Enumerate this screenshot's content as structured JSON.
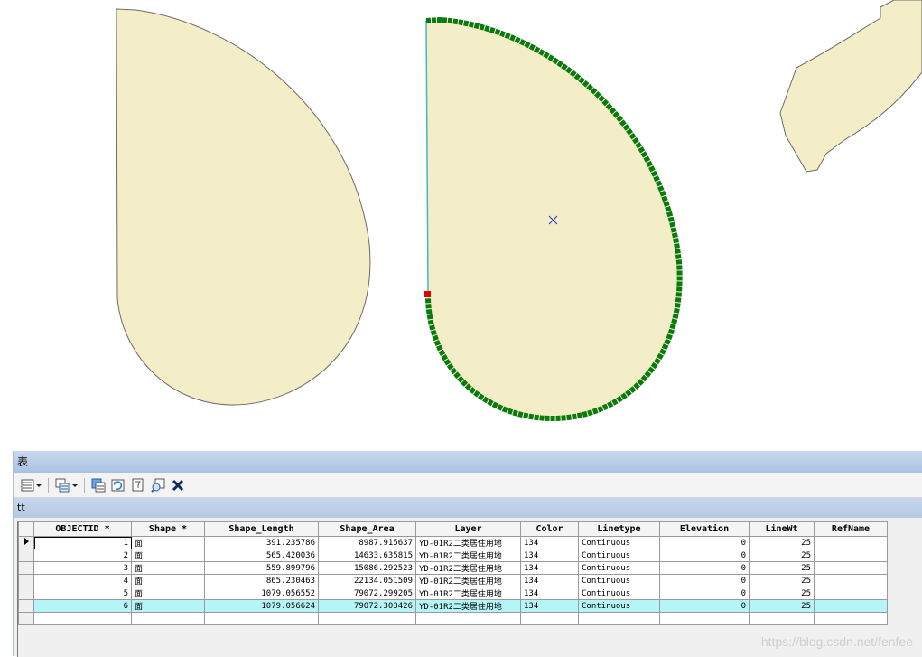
{
  "window_title": "表",
  "table_tab": "tt",
  "toolbar": {
    "icons": [
      "table-options-icon",
      "dropdown-arrow-icon",
      "related-tables-icon",
      "dropdown-arrow-icon",
      "select-by-attributes-icon",
      "switch-selection-icon",
      "clear-selection-icon",
      "zoom-to-selected-icon",
      "delete-selected-icon"
    ]
  },
  "columns": [
    "OBJECTID *",
    "Shape *",
    "Shape_Length",
    "Shape_Area",
    "Layer",
    "Color",
    "Linetype",
    "Elevation",
    "LineWt",
    "RefName"
  ],
  "rows": [
    {
      "objectid": "1",
      "shape": "面",
      "length": "391.235786",
      "area": "8987.915637",
      "layer": "YD-01R2二类居住用地",
      "color": "134",
      "linetype": "Continuous",
      "elevation": "0",
      "linewt": "25",
      "refname": ""
    },
    {
      "objectid": "2",
      "shape": "面",
      "length": "565.420036",
      "area": "14633.635815",
      "layer": "YD-01R2二类居住用地",
      "color": "134",
      "linetype": "Continuous",
      "elevation": "0",
      "linewt": "25",
      "refname": ""
    },
    {
      "objectid": "3",
      "shape": "面",
      "length": "559.899796",
      "area": "15086.292523",
      "layer": "YD-01R2二类居住用地",
      "color": "134",
      "linetype": "Continuous",
      "elevation": "0",
      "linewt": "25",
      "refname": ""
    },
    {
      "objectid": "4",
      "shape": "面",
      "length": "865.230463",
      "area": "22134.051509",
      "layer": "YD-01R2二类居住用地",
      "color": "134",
      "linetype": "Continuous",
      "elevation": "0",
      "linewt": "25",
      "refname": ""
    },
    {
      "objectid": "5",
      "shape": "面",
      "length": "1079.056552",
      "area": "79072.299205",
      "layer": "YD-01R2二类居住用地",
      "color": "134",
      "linetype": "Continuous",
      "elevation": "0",
      "linewt": "25",
      "refname": ""
    },
    {
      "objectid": "6",
      "shape": "面",
      "length": "1079.056624",
      "area": "79072.303426",
      "layer": "YD-01R2二类居住用地",
      "color": "134",
      "linetype": "Continuous",
      "elevation": "0",
      "linewt": "25",
      "refname": ""
    }
  ],
  "highlighted_row": 6,
  "current_row": 1,
  "watermark": "https://blog.csdn.net/fenfee",
  "colors": {
    "polygon_fill": "#f3edc8",
    "vertex_edit": "#0a7a0a",
    "selected_row": "#b5f5f7",
    "title_bar": "#b7cbe6"
  }
}
